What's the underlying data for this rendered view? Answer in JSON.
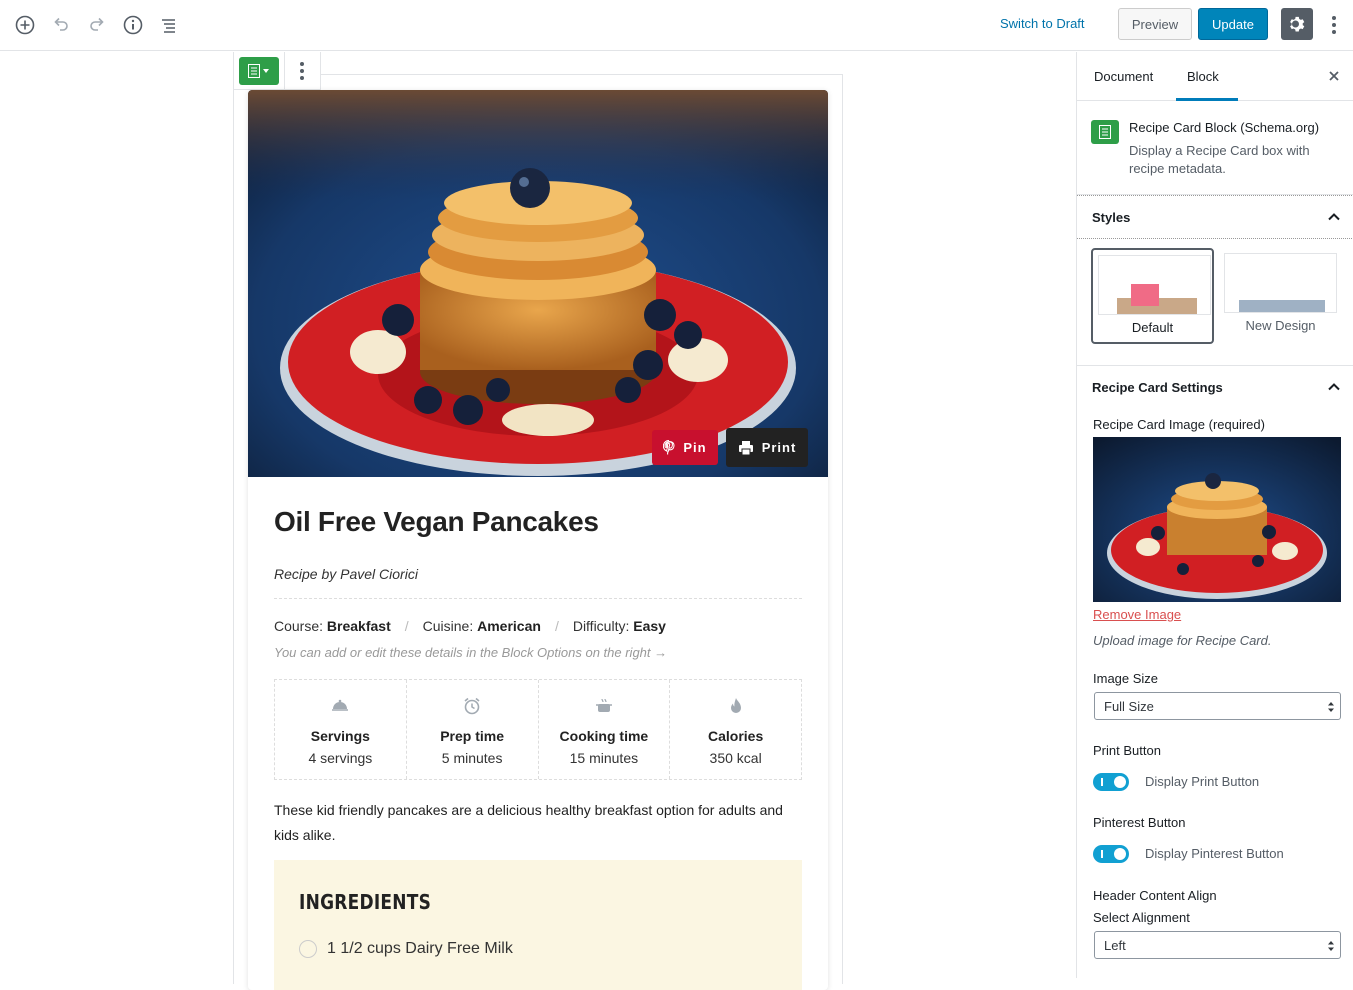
{
  "toolbar": {
    "switch_to_draft": "Switch to Draft",
    "preview": "Preview",
    "update": "Update",
    "icons": [
      "add-block-icon",
      "undo-icon",
      "redo-icon",
      "info-icon",
      "outline-icon",
      "gear-icon",
      "more-vertical-icon"
    ]
  },
  "recipe": {
    "pin_label": "Pin",
    "print_label": "Print",
    "title": "Oil Free Vegan Pancakes",
    "author": "Recipe by Pavel Ciorici",
    "meta": {
      "course_key": "Course:",
      "course_val": "Breakfast",
      "cuisine_key": "Cuisine:",
      "cuisine_val": "American",
      "difficulty_key": "Difficulty:",
      "difficulty_val": "Easy",
      "sep": "/"
    },
    "hint": "You can add or edit these details in the Block Options on the right →",
    "details": [
      {
        "label": "Servings",
        "value": "4 servings",
        "icon": "servings-icon"
      },
      {
        "label": "Prep time",
        "value": "5 minutes",
        "icon": "alarm-clock-icon"
      },
      {
        "label": "Cooking time",
        "value": "15 minutes",
        "icon": "cooking-pot-icon"
      },
      {
        "label": "Calories",
        "value": "350 kcal",
        "icon": "flame-icon"
      }
    ],
    "summary": "These kid friendly pancakes are a delicious healthy breakfast option for adults and kids alike.",
    "ingredients_title": "INGREDIENTS",
    "ingredients": [
      "1 1/2 cups Dairy Free Milk"
    ]
  },
  "sidebar": {
    "tab_document": "Document",
    "tab_block": "Block",
    "block_name": "Recipe Card Block (Schema.org)",
    "block_desc": "Display a Recipe Card box with recipe metadata.",
    "styles_title": "Styles",
    "style_default": "Default",
    "style_new": "New Design",
    "settings_title": "Recipe Card Settings",
    "image_label": "Recipe Card Image (required)",
    "remove_image": "Remove Image",
    "upload_help": "Upload image for Recipe Card.",
    "image_size_label": "Image Size",
    "image_size_value": "Full Size",
    "print_button_label": "Print Button",
    "print_toggle_label": "Display Print Button",
    "print_toggle_on": true,
    "pinterest_button_label": "Pinterest Button",
    "pinterest_toggle_label": "Display Pinterest Button",
    "pinterest_toggle_on": true,
    "header_align_label": "Header Content Align",
    "select_alignment_label": "Select Alignment",
    "alignment_value": "Left"
  },
  "colors": {
    "accent": "#0085ba",
    "toggle": "#11a0d2",
    "block_icon": "#2e9e48",
    "pin": "#c8102e",
    "ingredients_bg": "#fbf6e2"
  }
}
